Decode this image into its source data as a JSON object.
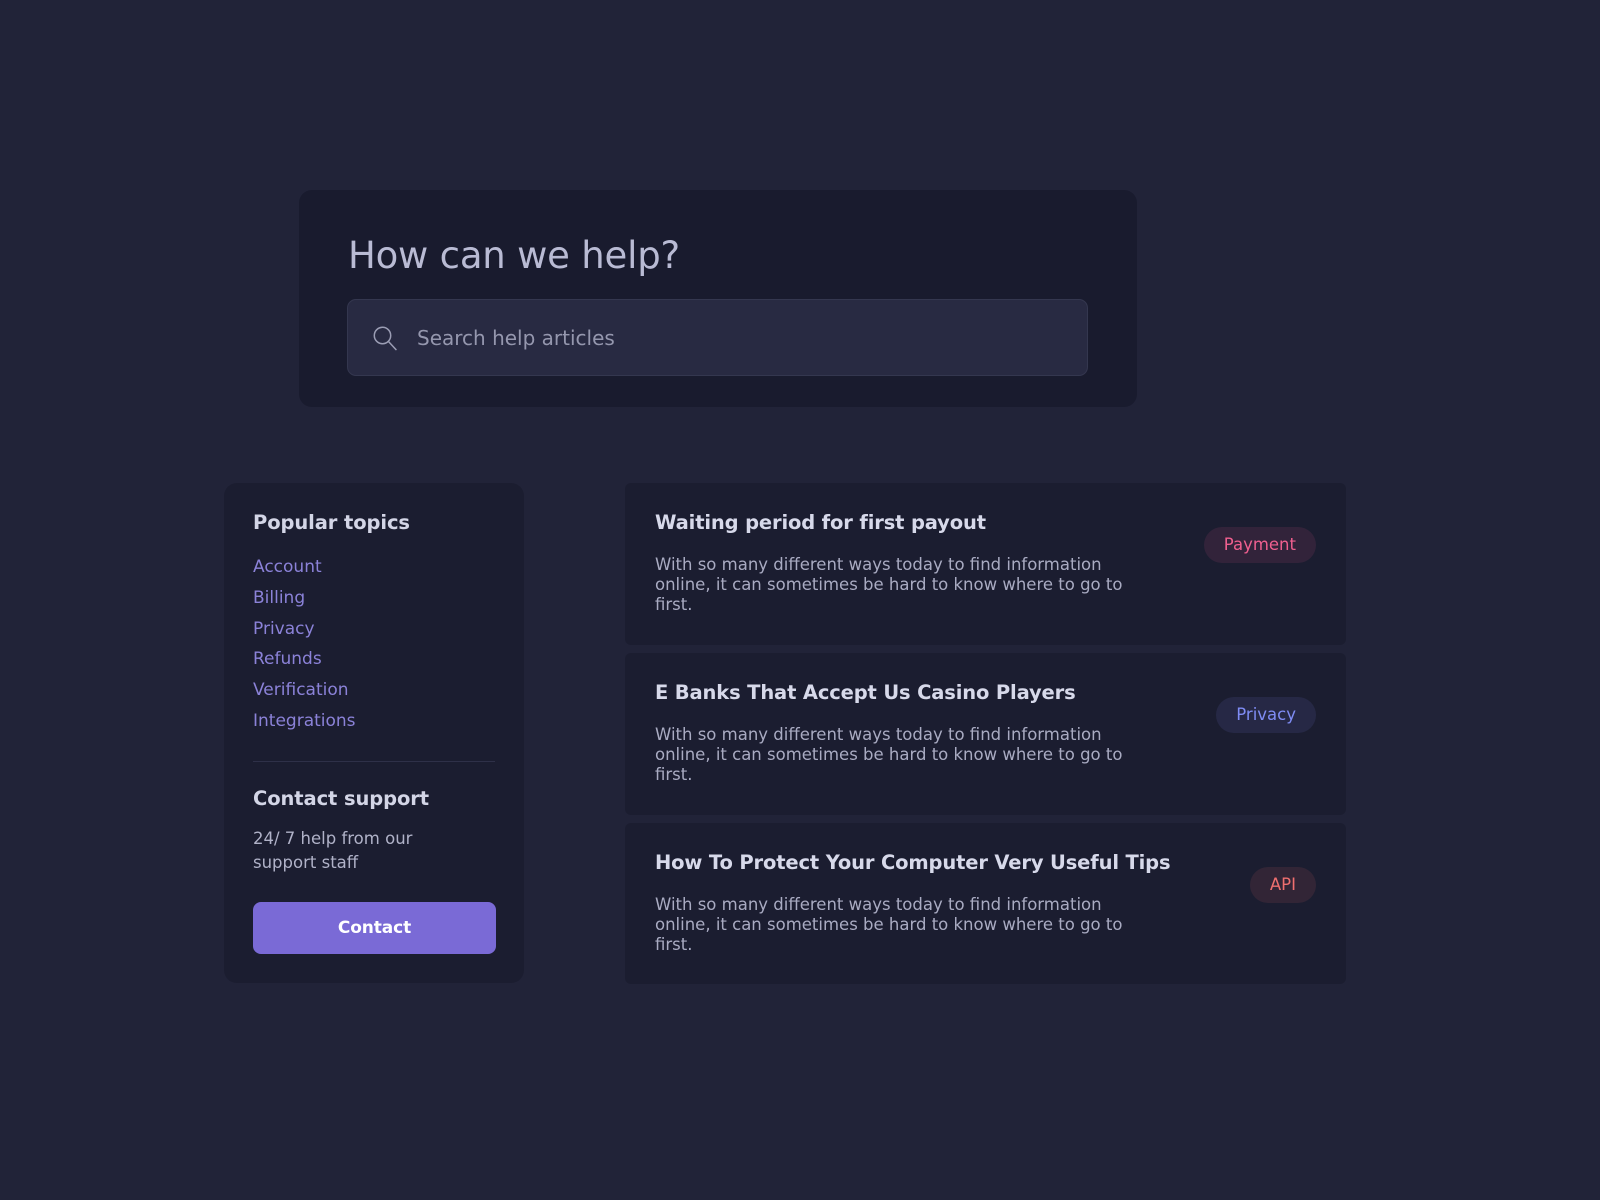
{
  "hero": {
    "title": "How can we help?",
    "search": {
      "icon": "search-icon",
      "value": "",
      "placeholder": "Search help articles"
    }
  },
  "sidebar": {
    "topics_heading": "Popular topics",
    "topics": [
      {
        "label": "Account"
      },
      {
        "label": "Billing"
      },
      {
        "label": "Privacy"
      },
      {
        "label": "Refunds"
      },
      {
        "label": "Verification"
      },
      {
        "label": "Integrations"
      }
    ],
    "contact_heading": "Contact support",
    "contact_copy": "24/ 7 help from our support staff",
    "contact_button": "Contact"
  },
  "articles": [
    {
      "title": "Waiting period for first payout",
      "excerpt": "With so many different ways today to find information online, it can sometimes be hard to know where to go to first.",
      "badge": "Payment",
      "badge_color": "#ef5f8f"
    },
    {
      "title": "E Banks That Accept Us Casino Players",
      "excerpt": "With so many different ways today to find information online, it can sometimes be hard to know where to go to first.",
      "badge": "Privacy",
      "badge_color": "#7f8cf4"
    },
    {
      "title": "How To Protect Your Computer Very Useful Tips",
      "excerpt": "With so many different ways today to find information online, it can sometimes be hard to know where to go to first.",
      "badge": "API",
      "badge_color": "#ef6f6f"
    }
  ],
  "theme": {
    "page_background": "#212338",
    "hero_background": "#191b2e",
    "card_background": "#1b1d30",
    "input_background": "#282a42",
    "accent": "#7a6ad6"
  }
}
